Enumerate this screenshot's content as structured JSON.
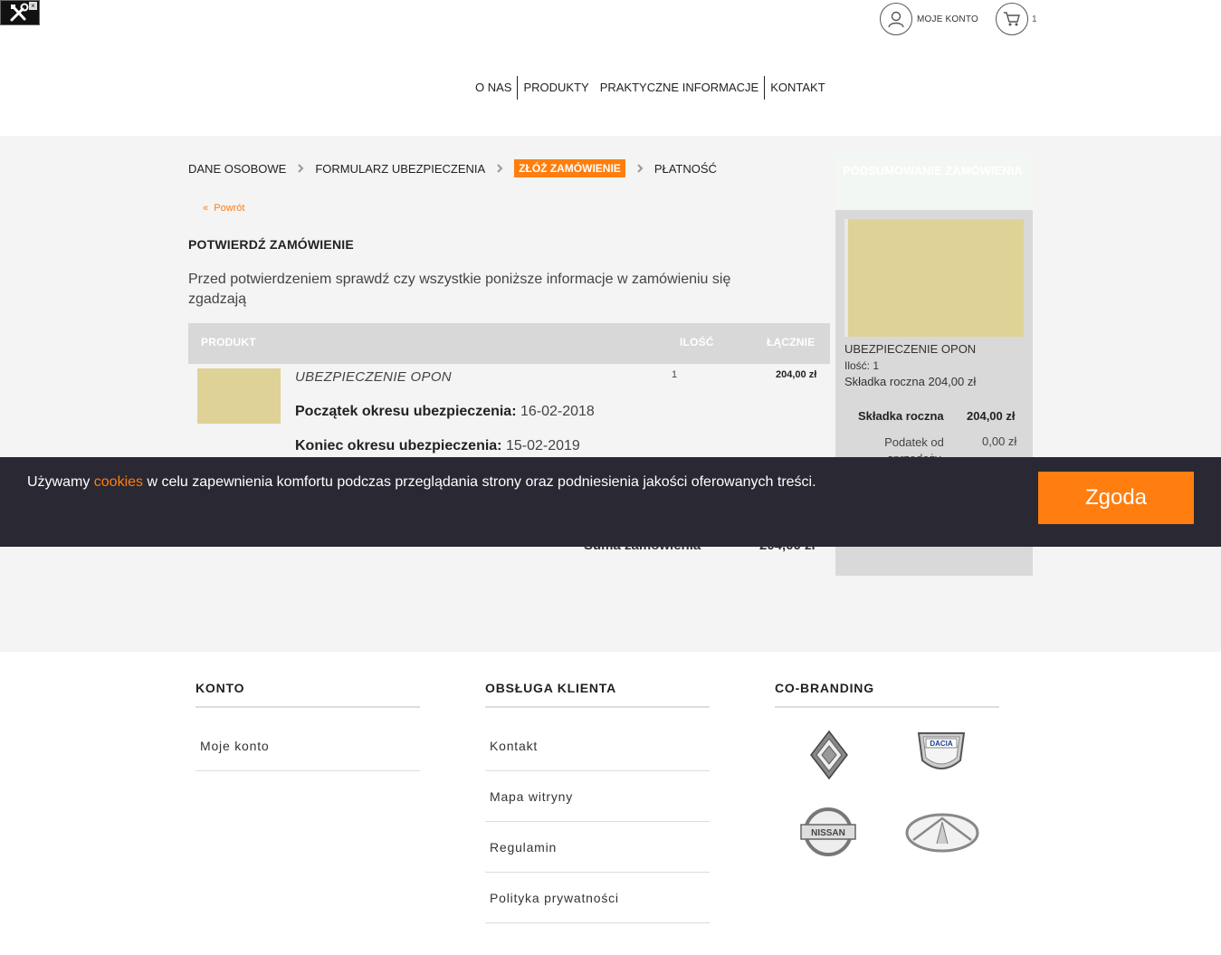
{
  "header": {
    "account_label": "MOJE KONTO",
    "cart_count": "1",
    "nav": [
      "O NAS",
      "PRODUKTY",
      "PRAKTYCZNE INFORMACJE",
      "KONTAKT"
    ]
  },
  "steps": [
    "DANE OSOBOWE",
    "FORMULARZ UBEZPIECZENIA",
    "ZŁÓŻ ZAMÓWIENIE",
    "PŁATNOŚĆ"
  ],
  "back_label": "Powrót",
  "page_title": "POTWIERDŹ ZAMÓWIENIE",
  "intro": "Przed potwierdzeniem sprawdź czy wszystkie poniższe informacje w zamówieniu się zgadzają",
  "table": {
    "headers": [
      "PRODUKT",
      "ILOŚĆ",
      "ŁĄCZNIE"
    ],
    "row": {
      "name": "UBEZPIECZENIE OPON",
      "qty": "1",
      "total": "204,00 zł",
      "start_label": "Początek okresu ubezpieczenia:",
      "start_value": "16-02-2018",
      "end_label": "Koniec okresu ubezpieczenia:",
      "end_value": "15-02-2019"
    },
    "sum_label": "Suma zamówienia",
    "sum_value": "204,00 zł"
  },
  "summary": {
    "title": "PODSUMOWANIE ZAMÓWIENIA",
    "product": "UBEZPIECZENIE OPON",
    "qty": "Ilość: 1",
    "premium_line": "Składka roczna 204,00 zł",
    "premium_label": "Składka roczna",
    "premium_value": "204,00 zł",
    "tax_label": "Podatek od sprzedaży",
    "tax_value": "0,00 zł"
  },
  "cookie": {
    "before": "Używamy ",
    "link": "cookies",
    "after": " w celu zapewnienia komfortu podczas przeglądania strony oraz podniesienia jakości oferowanych treści.",
    "button": "Zgoda"
  },
  "footer": {
    "account": {
      "heading": "KONTO",
      "links": [
        "Moje konto"
      ]
    },
    "service": {
      "heading": "OBSŁUGA KLIENTA",
      "links": [
        "Kontakt",
        "Mapa witryny",
        "Regulamin",
        "Polityka prywatności"
      ]
    },
    "cobranding": {
      "heading": "CO-BRANDING",
      "brands": [
        "Renault",
        "Dacia",
        "Nissan",
        "Infiniti"
      ],
      "dacia_text": "DACIA",
      "nissan_text": "NISSAN"
    }
  },
  "colors": {
    "accent": "#ff7e0f",
    "banner": "#2a2832",
    "band": "#f4f4f4",
    "placeholder": "#dfd296"
  }
}
